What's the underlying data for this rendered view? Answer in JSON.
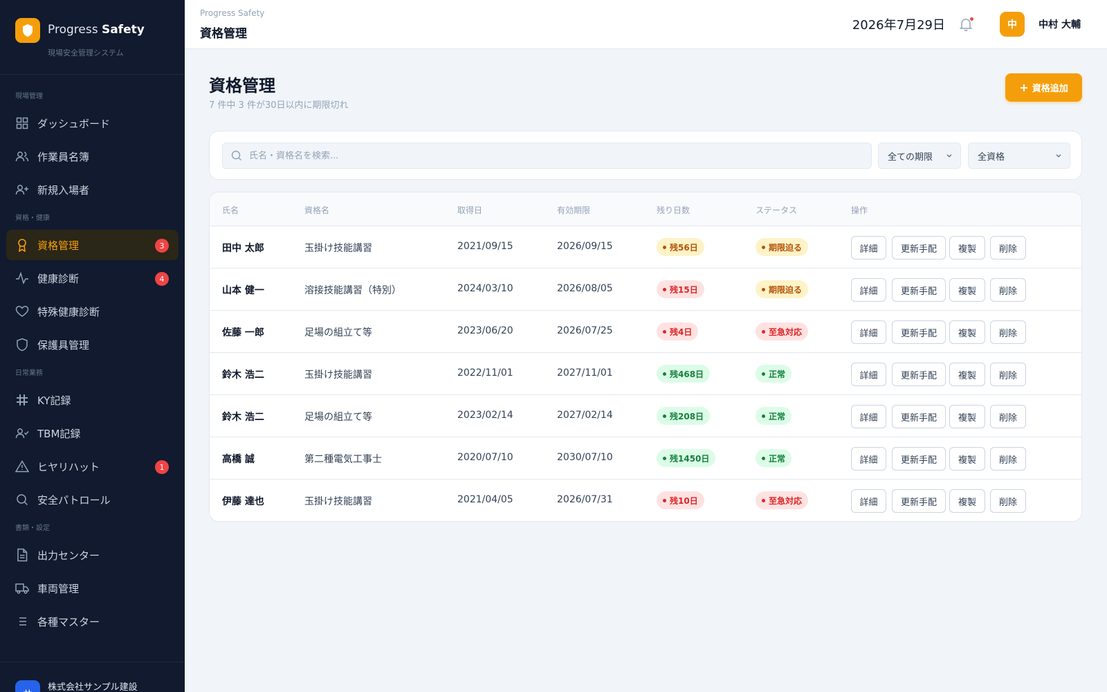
{
  "brand": {
    "name_prefix": "Progress ",
    "name_bold": "Safety",
    "subtitle": "現場安全管理システム"
  },
  "sidebar": {
    "sections": [
      {
        "label": "現場管理"
      },
      {
        "label": "資格・健康"
      },
      {
        "label": "日常業務"
      },
      {
        "label": "書類・設定"
      }
    ],
    "items": [
      {
        "label": "ダッシュボード",
        "icon": "grid-icon"
      },
      {
        "label": "作業員名簿",
        "icon": "users-icon"
      },
      {
        "label": "新規入場者",
        "icon": "user-plus-icon"
      },
      {
        "label": "資格管理",
        "icon": "award-icon",
        "active": true,
        "badge": "3"
      },
      {
        "label": "健康診断",
        "icon": "activity-icon",
        "badge": "4"
      },
      {
        "label": "特殊健康診断",
        "icon": "heart-icon"
      },
      {
        "label": "保護具管理",
        "icon": "shield-icon"
      },
      {
        "label": "KY記録",
        "icon": "hash-icon"
      },
      {
        "label": "TBM記録",
        "icon": "user-check-icon"
      },
      {
        "label": "ヒヤリハット",
        "icon": "alert-triangle-icon",
        "badge": "1"
      },
      {
        "label": "安全パトロール",
        "icon": "search-icon"
      },
      {
        "label": "出力センター",
        "icon": "file-icon"
      },
      {
        "label": "車両管理",
        "icon": "truck-icon"
      },
      {
        "label": "各種マスター",
        "icon": "list-icon"
      }
    ],
    "company": {
      "avatar": "サ",
      "name": "株式会社サンプル建設"
    }
  },
  "header": {
    "breadcrumb": "Progress Safety",
    "title": "資格管理",
    "date": "2026年7月29日",
    "user": {
      "avatar": "中",
      "name": "中村 大輔"
    }
  },
  "main": {
    "title": "資格管理",
    "subtitle": "7 件中 3 件が30日以内に期限切れ",
    "add_button": "資格追加",
    "search_placeholder": "氏名・資格名を検索...",
    "filter_period": "全ての期限",
    "filter_type": "全資格",
    "columns": [
      "氏名",
      "資格名",
      "取得日",
      "有効期限",
      "残り日数",
      "ステータス",
      "操作"
    ],
    "actions": [
      "詳細",
      "更新手配",
      "複製",
      "削除"
    ],
    "rows": [
      {
        "name": "田中 太郎",
        "qualification": "玉掛け技能講習",
        "acquired": "2021/09/15",
        "expires": "2026/09/15",
        "remaining": "残56日",
        "remaining_level": "warn",
        "status": "期限迫る",
        "status_level": "warn"
      },
      {
        "name": "山本 健一",
        "qualification": "溶接技能講習（特別）",
        "acquired": "2024/03/10",
        "expires": "2026/08/05",
        "remaining": "残15日",
        "remaining_level": "danger",
        "status": "期限迫る",
        "status_level": "warn"
      },
      {
        "name": "佐藤 一郎",
        "qualification": "足場の組立て等",
        "acquired": "2023/06/20",
        "expires": "2026/07/25",
        "remaining": "残4日",
        "remaining_level": "danger",
        "status": "至急対応",
        "status_level": "danger"
      },
      {
        "name": "鈴木 浩二",
        "qualification": "玉掛け技能講習",
        "acquired": "2022/11/01",
        "expires": "2027/11/01",
        "remaining": "残468日",
        "remaining_level": "ok",
        "status": "正常",
        "status_level": "ok"
      },
      {
        "name": "鈴木 浩二",
        "qualification": "足場の組立て等",
        "acquired": "2023/02/14",
        "expires": "2027/02/14",
        "remaining": "残208日",
        "remaining_level": "ok",
        "status": "正常",
        "status_level": "ok"
      },
      {
        "name": "高橋 誠",
        "qualification": "第二種電気工事士",
        "acquired": "2020/07/10",
        "expires": "2030/07/10",
        "remaining": "残1450日",
        "remaining_level": "ok",
        "status": "正常",
        "status_level": "ok"
      },
      {
        "name": "伊藤 達也",
        "qualification": "玉掛け技能講習",
        "acquired": "2021/04/05",
        "expires": "2026/07/31",
        "remaining": "残10日",
        "remaining_level": "danger",
        "status": "至急対応",
        "status_level": "danger"
      }
    ]
  },
  "colors": {
    "accent": "#f59e0b",
    "sidebar_bg": "#111a2e",
    "danger": "#ef4444",
    "ok": "#15803d"
  }
}
